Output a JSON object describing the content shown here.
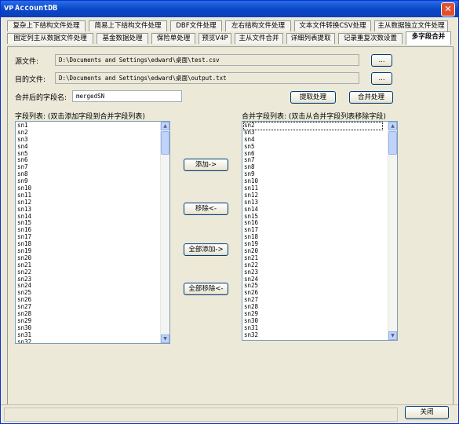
{
  "window": {
    "icon": "VP",
    "title": "AccountDB",
    "close_symbol": "✕"
  },
  "tabs_row1": [
    "复杂上下结构文件处理",
    "简易上下结构文件处理",
    "DBF文件处理",
    "左右结构文件处理",
    "文本文件转换CSV处理",
    "主从数据独立文件处理"
  ],
  "tabs_row2": [
    "固定列主从数据文件处理",
    "基金数据处理",
    "保险单处理",
    "预览V4P",
    "主从文件合并",
    "详细列表提取",
    "记录重复次数设置",
    "多字段合并"
  ],
  "form": {
    "source_label": "源文件:",
    "source_value": "D:\\Documents and Settings\\edward\\桌面\\test.csv",
    "dest_label": "目的文件:",
    "dest_value": "D:\\Documents and Settings\\edward\\桌面\\output.txt",
    "browse_label": "...",
    "merged_name_label": "合并后的字段名:",
    "merged_name_value": "mergedSN",
    "extract_button": "提取处理",
    "merge_button": "合并处理"
  },
  "left_list": {
    "header": "字段列表: (双击添加字段到合并字段列表)",
    "items": [
      "sn1",
      "sn2",
      "sn3",
      "sn4",
      "sn5",
      "sn6",
      "sn7",
      "sn8",
      "sn9",
      "sn10",
      "sn11",
      "sn12",
      "sn13",
      "sn14",
      "sn15",
      "sn16",
      "sn17",
      "sn18",
      "sn19",
      "sn20",
      "sn21",
      "sn22",
      "sn23",
      "sn24",
      "sn25",
      "sn26",
      "sn27",
      "sn28",
      "sn29",
      "sn30",
      "sn31",
      "sn32"
    ]
  },
  "right_list": {
    "header": "合并字段列表: (双击从合并字段列表移除字段)",
    "items": [
      "sn2",
      "sn3",
      "sn4",
      "sn5",
      "sn6",
      "sn7",
      "sn8",
      "sn9",
      "sn10",
      "sn11",
      "sn12",
      "sn13",
      "sn14",
      "sn15",
      "sn16",
      "sn17",
      "sn18",
      "sn19",
      "sn20",
      "sn21",
      "sn22",
      "sn23",
      "sn24",
      "sn25",
      "sn26",
      "sn27",
      "sn28",
      "sn29",
      "sn30",
      "sn31",
      "sn32"
    ]
  },
  "transfer_buttons": {
    "add": "添加->",
    "remove": "移除<-",
    "add_all": "全部添加->",
    "remove_all": "全部移除<-"
  },
  "footer": {
    "close_button": "关闭"
  },
  "colors": {
    "titlebar": "#0a47c9",
    "active_tab_underline": "#e00000"
  }
}
